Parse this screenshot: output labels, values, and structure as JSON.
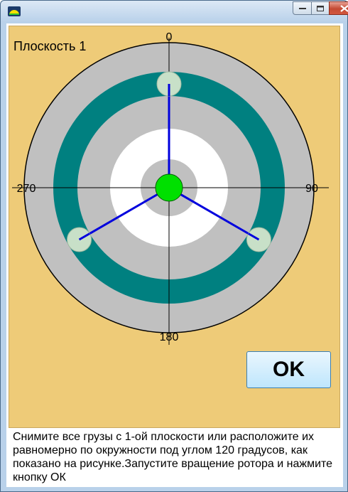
{
  "window": {
    "title": "",
    "controls": {
      "minimize": "minimize",
      "maximize": "maximize",
      "close": "close"
    }
  },
  "canvas": {
    "plane_label": "Плоскость 1",
    "angle_labels": {
      "top": "0",
      "right": "90",
      "bottom": "180",
      "left": "270"
    },
    "weights_angles_deg": [
      0,
      120,
      240
    ],
    "colors": {
      "background": "#eecb78",
      "outer_ring": "#c0c0c0",
      "teal_ring": "#008080",
      "inner_gray": "#c0c0c0",
      "white_ring": "#ffffff",
      "hub": "#00e000",
      "weight": "#c8e0c8",
      "spoke": "#0000dd"
    }
  },
  "ok_button": {
    "label": "OK"
  },
  "instructions": {
    "text": "Снимите все грузы с 1-ой плоскости или расположите их равномерно по окружности под углом 120 градусов, как показано на рисунке.Запустите вращение ротора и нажмите кнопку ОК"
  }
}
